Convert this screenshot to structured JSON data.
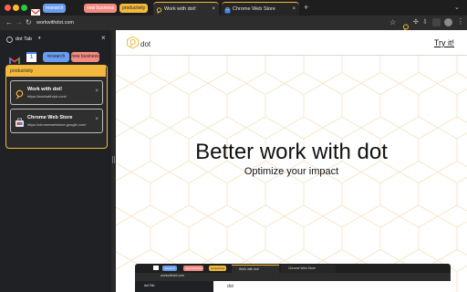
{
  "tabstrip": {
    "chips": [
      {
        "label": "research",
        "color": "#6a9df1"
      },
      {
        "label": "new business",
        "color": "#f28b82"
      },
      {
        "label": "productivity",
        "color": "#f3b93c"
      }
    ],
    "tabs": [
      {
        "title": "Work with dot!",
        "active": true
      },
      {
        "title": "Chrome Web Store",
        "active": false
      }
    ],
    "new_tab": "+"
  },
  "toolbar": {
    "url": "workwithdot.com"
  },
  "sidepanel": {
    "title": "dot Tab",
    "chips": [
      "research",
      "new business"
    ],
    "group_label": "productivity",
    "items": [
      {
        "title": "Work with dot!",
        "url": "https://workwithdot.com/"
      },
      {
        "title": "Chrome Web Store",
        "url": "https://chromewebstore.google.com/"
      }
    ]
  },
  "page": {
    "brand": "dot",
    "cta": "Try it!",
    "headline": "Better work with dot",
    "subheadline": "Optimize your impact"
  },
  "mini_browser": {
    "url": "workwithdot.com",
    "side_title": "dot Tab",
    "brand": "dot",
    "chips": [
      "research",
      "new business",
      "productivity"
    ],
    "tabs": [
      "Work with dot!",
      "Chrome Web Store"
    ]
  },
  "colors": {
    "accent": "#f3b93c",
    "research": "#6a9df1",
    "new_business": "#f28b82"
  }
}
